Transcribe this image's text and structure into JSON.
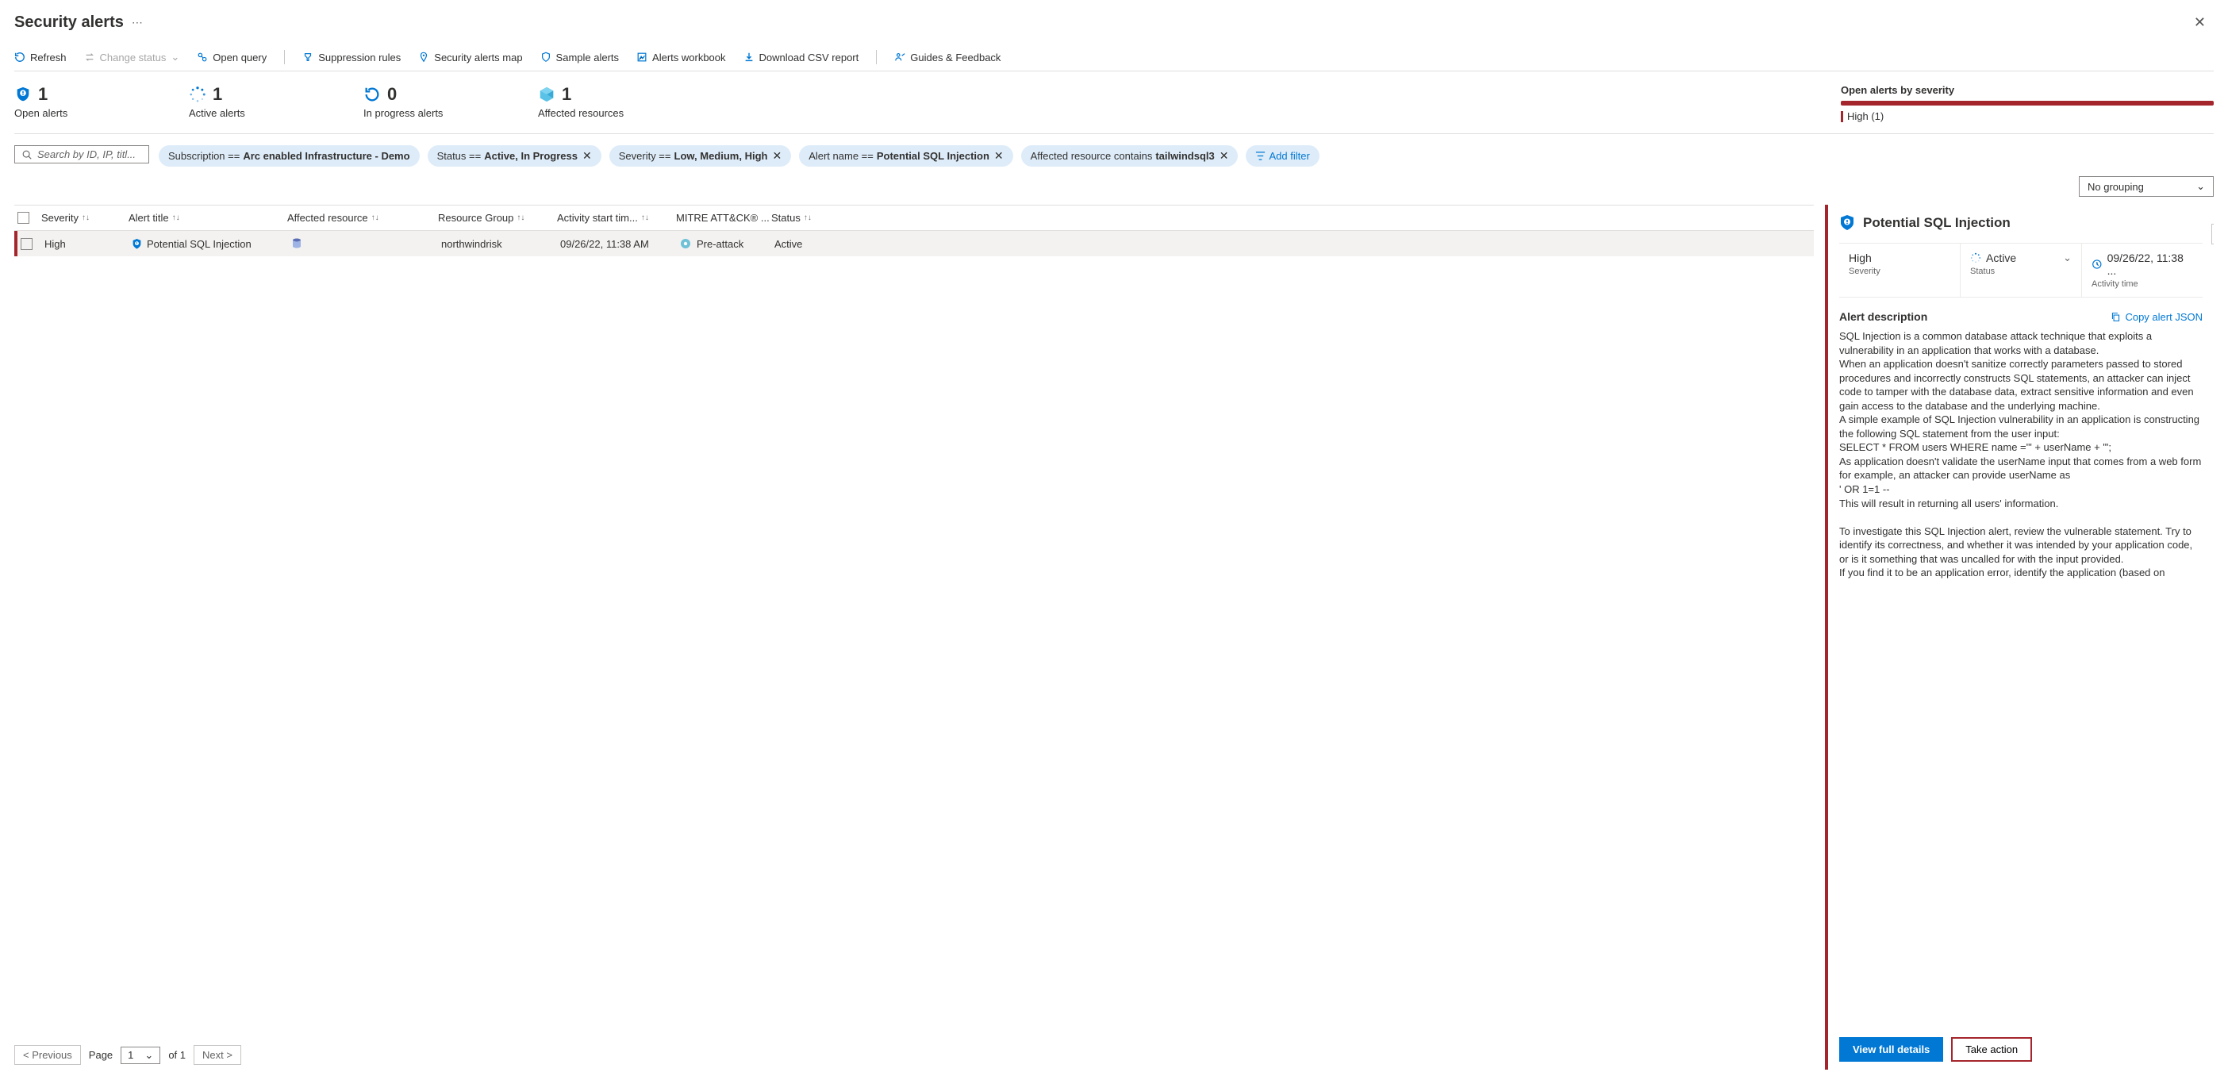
{
  "header": {
    "title": "Security alerts"
  },
  "toolbar": {
    "refresh": "Refresh",
    "changeStatus": "Change status",
    "openQuery": "Open query",
    "suppression": "Suppression rules",
    "alertsMap": "Security alerts map",
    "sample": "Sample alerts",
    "workbook": "Alerts workbook",
    "csv": "Download CSV report",
    "guides": "Guides & Feedback"
  },
  "kpi": {
    "open": {
      "value": "1",
      "label": "Open alerts"
    },
    "active": {
      "value": "1",
      "label": "Active alerts"
    },
    "progress": {
      "value": "0",
      "label": "In progress alerts"
    },
    "affected": {
      "value": "1",
      "label": "Affected resources"
    }
  },
  "severity": {
    "title": "Open alerts by severity",
    "legend": "High (1)"
  },
  "search": {
    "placeholder": "Search by ID, IP, titl..."
  },
  "filters": {
    "sub": {
      "k": "Subscription == ",
      "v": "Arc enabled Infrastructure - Demo"
    },
    "status": {
      "k": "Status == ",
      "v": "Active, In Progress"
    },
    "sev": {
      "k": "Severity == ",
      "v": "Low, Medium, High"
    },
    "name": {
      "k": "Alert name == ",
      "v": "Potential SQL Injection"
    },
    "res": {
      "k": "Affected resource contains ",
      "v": "tailwindsql3"
    },
    "add": "Add filter"
  },
  "grouping": "No grouping",
  "columns": {
    "severity": "Severity",
    "title": "Alert title",
    "resource": "Affected resource",
    "rg": "Resource Group",
    "time": "Activity start tim...",
    "mitre": "MITRE ATT&CK® ...",
    "status": "Status"
  },
  "row": {
    "severity": "High",
    "title": "Potential SQL Injection",
    "rg": "northwindrisk",
    "time": "09/26/22, 11:38 AM",
    "mitre": "Pre-attack",
    "status": "Active"
  },
  "panel": {
    "title": "Potential SQL Injection",
    "sev": {
      "v": "High",
      "l": "Severity"
    },
    "status": {
      "v": "Active",
      "l": "Status"
    },
    "time": {
      "v": "09/26/22, 11:38 ...",
      "l": "Activity time"
    },
    "descHdr": "Alert description",
    "copy": "Copy alert JSON",
    "desc": "SQL Injection is a common database attack technique that exploits a vulnerability in an application that works with a database.\nWhen an application doesn't sanitize correctly parameters passed to stored procedures and incorrectly constructs SQL statements, an attacker can inject code to tamper with the database data, extract sensitive information and even gain access to the database and the underlying machine.\nA simple example of SQL Injection vulnerability in an application is constructing the following SQL statement from the user input:\nSELECT * FROM users WHERE name ='\" + userName + \"';\nAs application doesn't validate the userName input that comes from a web form for example, an attacker can provide userName as\n' OR 1=1 --\nThis will result in returning all users' information.\n\nTo investigate this SQL Injection alert, review the vulnerable statement. Try to identify its correctness, and whether it was intended by your application code, or is it something that was uncalled for with the input provided.\nIf you find it to be an application error, identify the application (based on",
    "viewFull": "View full details",
    "takeAction": "Take action"
  },
  "pager": {
    "prev": "< Previous",
    "pageLbl": "Page",
    "page": "1",
    "of": "of  1",
    "next": "Next >"
  }
}
